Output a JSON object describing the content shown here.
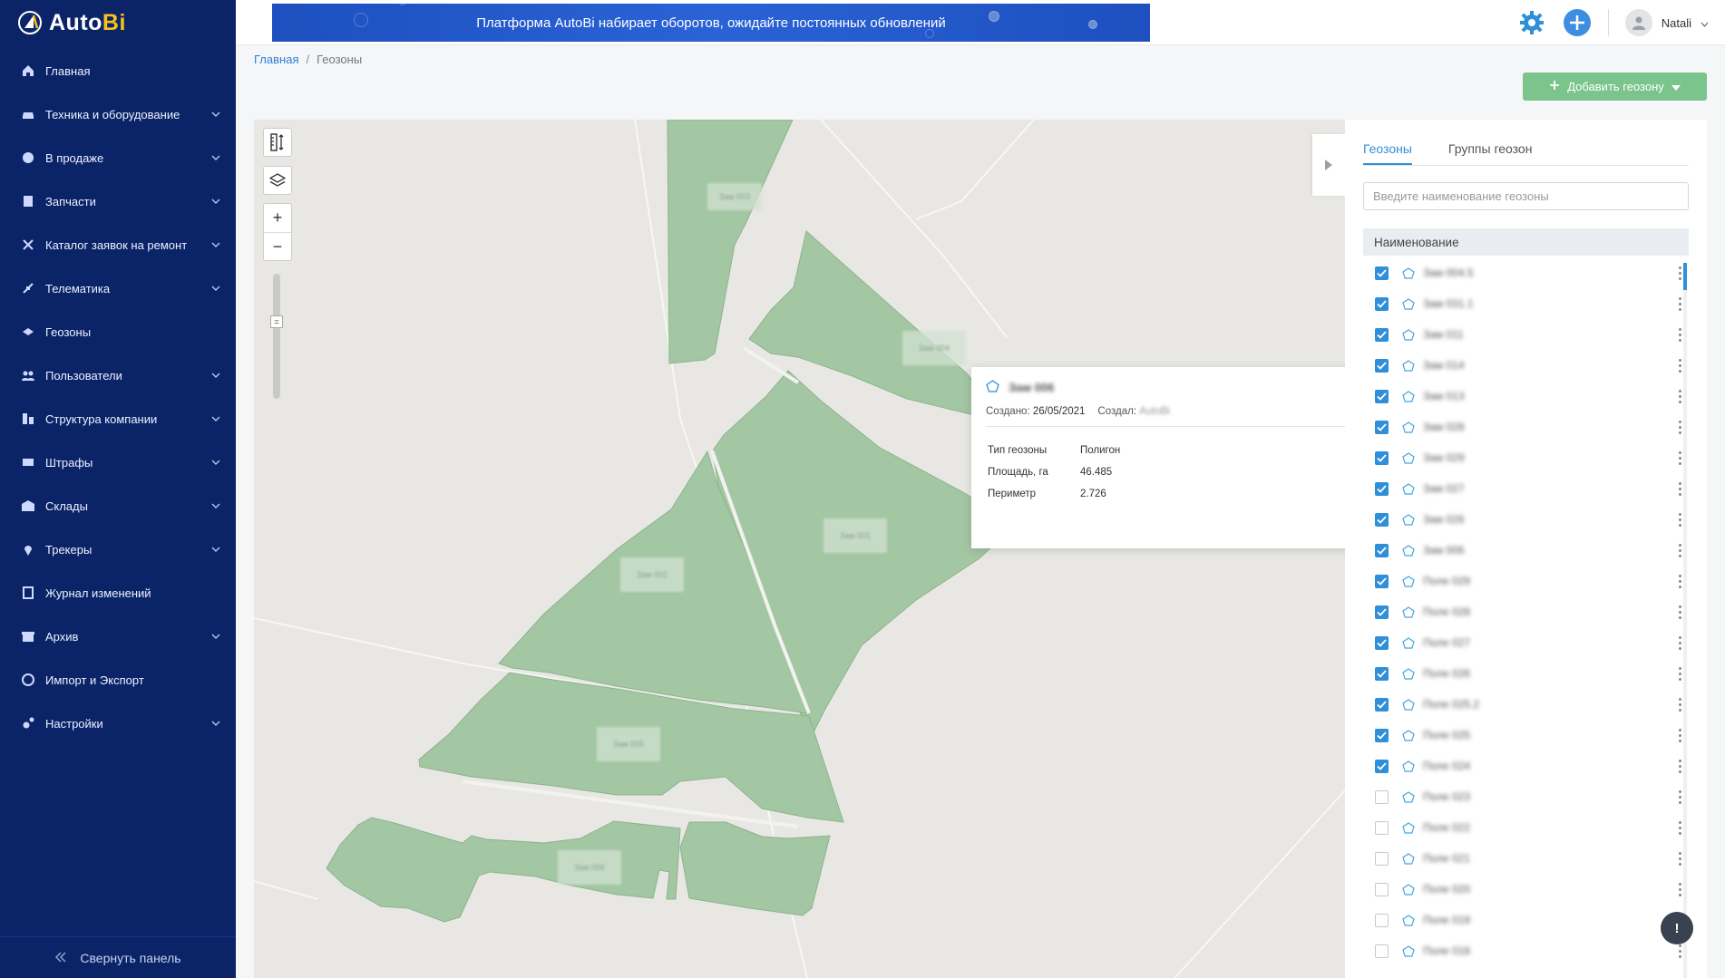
{
  "app": {
    "name_main": "Auto",
    "name_accent": "Bi"
  },
  "sidebar": {
    "items": [
      {
        "label": "Главная",
        "icon": "home-icon",
        "has_children": false
      },
      {
        "label": "Техника и оборудование",
        "icon": "car-icon",
        "has_children": true
      },
      {
        "label": "В продаже",
        "icon": "sale-icon",
        "has_children": true
      },
      {
        "label": "Запчасти",
        "icon": "parts-icon",
        "has_children": true
      },
      {
        "label": "Каталог заявок на ремонт",
        "icon": "wrench-icon",
        "has_children": true
      },
      {
        "label": "Телематика",
        "icon": "satellite-icon",
        "has_children": true
      },
      {
        "label": "Геозоны",
        "icon": "geozone-icon",
        "has_children": false
      },
      {
        "label": "Пользователи",
        "icon": "users-icon",
        "has_children": true
      },
      {
        "label": "Структура компании",
        "icon": "structure-icon",
        "has_children": true
      },
      {
        "label": "Штрафы",
        "icon": "fine-icon",
        "has_children": true
      },
      {
        "label": "Склады",
        "icon": "warehouse-icon",
        "has_children": true
      },
      {
        "label": "Трекеры",
        "icon": "pin-icon",
        "has_children": true
      },
      {
        "label": "Журнал изменений",
        "icon": "journal-icon",
        "has_children": false
      },
      {
        "label": "Архив",
        "icon": "archive-icon",
        "has_children": true
      },
      {
        "label": "Импорт и Экспорт",
        "icon": "import-export-icon",
        "has_children": false
      },
      {
        "label": "Настройки",
        "icon": "settings-icon",
        "has_children": true
      }
    ],
    "collapse_label": "Свернуть панель"
  },
  "topbar": {
    "banner_text": "Платформа AutoBi набирает оборотов, ожидайте постоянных обновлений",
    "user_name": "Natali"
  },
  "breadcrumb": {
    "home": "Главная",
    "separator": "/",
    "current": "Геозоны"
  },
  "actions": {
    "add_geozone": "Добавить геозону"
  },
  "popup": {
    "title": "Зам 006",
    "created_label": "Создано:",
    "created_value": "26/05/2021",
    "author_label": "Создал:",
    "author_value": "AutoBi",
    "props": [
      {
        "key": "Тип геозоны",
        "value": "Полигон"
      },
      {
        "key": "Площадь, га",
        "value": "46.485"
      },
      {
        "key": "Периметр",
        "value": "2.726"
      }
    ]
  },
  "panel": {
    "tabs": [
      {
        "label": "Геозоны",
        "active": true
      },
      {
        "label": "Группы геозон",
        "active": false
      }
    ],
    "search_placeholder": "Введите наименование геозоны",
    "column_header": "Наименование",
    "rows": [
      {
        "name": "Зам 004.5",
        "checked": true
      },
      {
        "name": "Зам 031.1",
        "checked": true
      },
      {
        "name": "Зам 011",
        "checked": true
      },
      {
        "name": "Зам 014",
        "checked": true
      },
      {
        "name": "Зам 013",
        "checked": true
      },
      {
        "name": "Зам 028",
        "checked": true
      },
      {
        "name": "Зам 029",
        "checked": true
      },
      {
        "name": "Зам 027",
        "checked": true
      },
      {
        "name": "Зам 026",
        "checked": true
      },
      {
        "name": "Зам 006",
        "checked": true
      },
      {
        "name": "Поле 029",
        "checked": true
      },
      {
        "name": "Поле 028",
        "checked": true
      },
      {
        "name": "Поле 027",
        "checked": true
      },
      {
        "name": "Поле 026",
        "checked": true
      },
      {
        "name": "Поле 025.2",
        "checked": true
      },
      {
        "name": "Поле 025",
        "checked": true
      },
      {
        "name": "Поле 024",
        "checked": true
      },
      {
        "name": "Поле 023",
        "checked": false
      },
      {
        "name": "Поле 022",
        "checked": false
      },
      {
        "name": "Поле 021",
        "checked": false
      },
      {
        "name": "Поле 020",
        "checked": false
      },
      {
        "name": "Поле 019",
        "checked": false
      },
      {
        "name": "Поле 018",
        "checked": false
      }
    ]
  },
  "map": {
    "zone_labels": [
      "Зам 003",
      "Зам 004",
      "Зам 001",
      "Зам 002",
      "Зам 005",
      "Зам 006"
    ]
  },
  "colors": {
    "sidebar_bg": "#0b2468",
    "accent_blue": "#2f8fd9",
    "add_button": "#7bc48b",
    "zone_fill": "#a3c6a3"
  }
}
